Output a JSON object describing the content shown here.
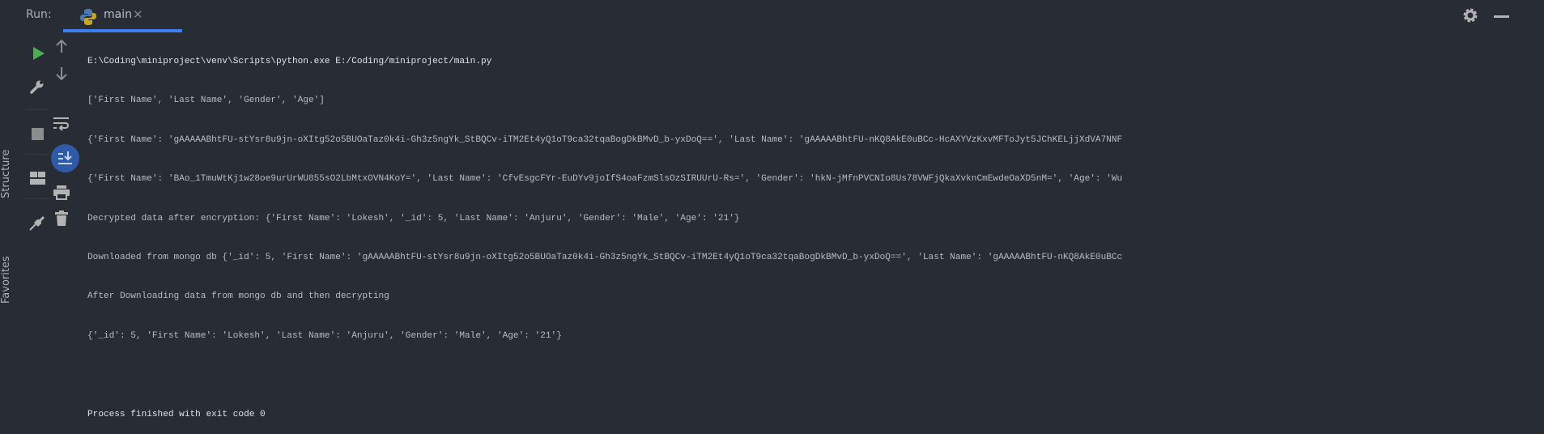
{
  "header": {
    "run_label": "Run:",
    "tab_label": "main"
  },
  "side_tabs": {
    "structure": "Structure",
    "favorites": "Favorites"
  },
  "console": {
    "lines": [
      "E:\\Coding\\miniproject\\venv\\Scripts\\python.exe E:/Coding/miniproject/main.py",
      "['First Name', 'Last Name', 'Gender', 'Age']",
      "{'First Name': 'gAAAAABhtFU-stYsr8u9jn-oXItg52o5BUOaTaz0k4i-Gh3z5ngYk_StBQCv-iTM2Et4yQ1oT9ca32tqaBogDkBMvD_b-yxDoQ==', 'Last Name': 'gAAAAABhtFU-nKQ8AkE0uBCc-HcAXYVzKxvMFToJyt5JChKELjjXdVA7NNF",
      "{'First Name': 'BAo_1TmuWtKj1w28oe9urUrWU855sO2LbMtxOVN4KoY=', 'Last Name': 'CfvEsgcFYr-EuDYv9joIfS4oaFzmSlsOzSIRUUrU-Rs=', 'Gender': 'hkN-jMfnPVCNIo8Us78VWFjQkaXvknCmEwdeOaXD5nM=', 'Age': 'Wu",
      "Decrypted data after encryption: {'First Name': 'Lokesh', '_id': 5, 'Last Name': 'Anjuru', 'Gender': 'Male', 'Age': '21'}",
      "Downloaded from mongo db {'_id': 5, 'First Name': 'gAAAAABhtFU-stYsr8u9jn-oXItg52o5BUOaTaz0k4i-Gh3z5ngYk_StBQCv-iTM2Et4yQ1oT9ca32tqaBogDkBMvD_b-yxDoQ==', 'Last Name': 'gAAAAABhtFU-nKQ8AkE0uBCc",
      "After Downloading data from mongo db and then decrypting",
      "{'_id': 5, 'First Name': 'Lokesh', 'Last Name': 'Anjuru', 'Gender': 'Male', 'Age': '21'}",
      "",
      "Process finished with exit code 0"
    ]
  },
  "colors": {
    "background": "#282c34",
    "accent": "#3d7ef0",
    "run_green": "#4caf50"
  }
}
